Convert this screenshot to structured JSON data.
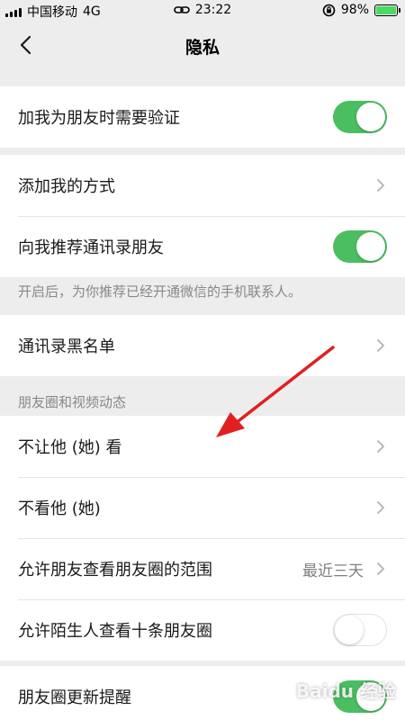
{
  "status_bar": {
    "carrier": "中国移动",
    "network": "4G",
    "time": "23:22",
    "battery": "98%"
  },
  "nav": {
    "title": "隐私"
  },
  "verify_row": {
    "label": "加我为朋友时需要验证",
    "toggle": "on"
  },
  "add_methods_row": {
    "label": "添加我的方式"
  },
  "recommend_row": {
    "label": "向我推荐通讯录朋友",
    "toggle": "on"
  },
  "recommend_note": "开启后，为你推荐已经开通微信的手机联系人。",
  "blacklist_row": {
    "label": "通讯录黑名单"
  },
  "moments_section": {
    "header": "朋友圈和视频动态"
  },
  "moments_rows": [
    {
      "label": "不让他 (她) 看"
    },
    {
      "label": "不看他 (她)"
    },
    {
      "label": "允许朋友查看朋友圈的范围",
      "value": "最近三天"
    },
    {
      "label": "允许陌生人查看十条朋友圈",
      "toggle": "off"
    }
  ],
  "update_row": {
    "label": "朋友圈更新提醒",
    "toggle": "on"
  },
  "watermark": "Baidu 经验",
  "colors": {
    "toggle_on": "#4cbe62",
    "annotation_arrow": "#e02020",
    "background": "#ededed"
  }
}
